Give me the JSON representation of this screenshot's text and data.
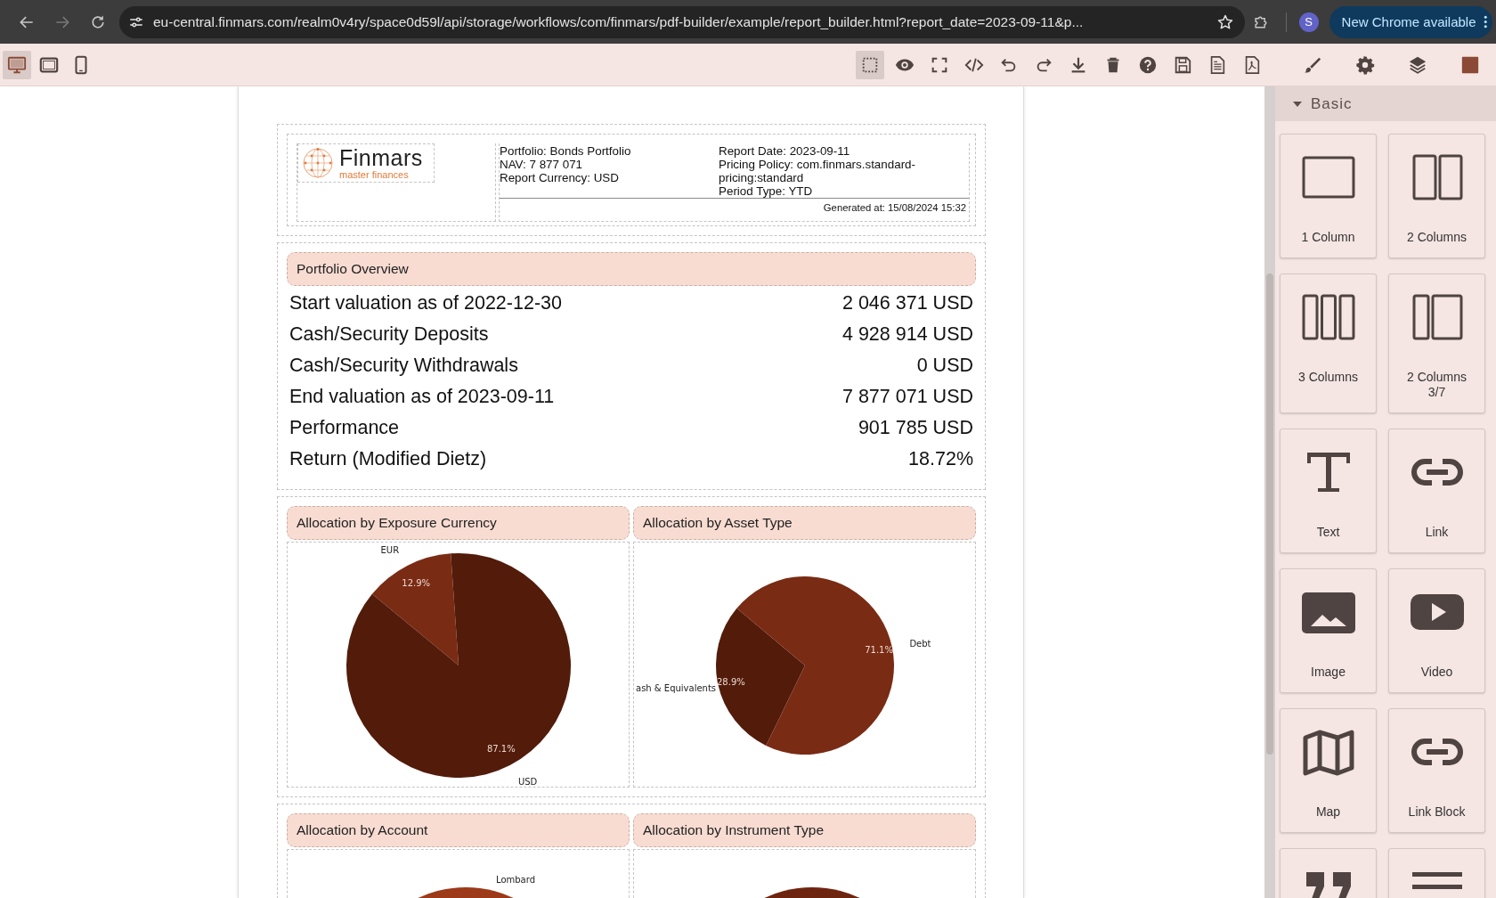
{
  "browser": {
    "url": "eu-central.finmars.com/realm0v4ry/space0d59l/api/storage/workflows/com/finmars/pdf-builder/example/report_builder.html?report_date=2023-09-11&p...",
    "profile_initial": "S",
    "update_button": "New Chrome available"
  },
  "toolbar": {
    "devices": [
      {
        "kind": "desktop",
        "selected": true
      },
      {
        "kind": "tablet",
        "selected": false
      },
      {
        "kind": "mobile",
        "selected": false
      }
    ],
    "commands": [
      {
        "kind": "select",
        "selected": true
      },
      {
        "kind": "preview",
        "selected": false
      },
      {
        "kind": "fullscreen",
        "selected": false
      },
      {
        "kind": "code",
        "selected": false
      },
      {
        "kind": "undo",
        "selected": false
      },
      {
        "kind": "redo",
        "selected": false
      },
      {
        "kind": "download",
        "selected": false
      },
      {
        "kind": "trash",
        "selected": false
      },
      {
        "kind": "help",
        "selected": false
      },
      {
        "kind": "save",
        "selected": false
      },
      {
        "kind": "document",
        "selected": false
      },
      {
        "kind": "pdf",
        "selected": false
      }
    ],
    "panels": [
      {
        "kind": "style",
        "selected": false
      },
      {
        "kind": "settings",
        "selected": false
      },
      {
        "kind": "layers",
        "selected": false
      },
      {
        "kind": "blocks",
        "selected": true
      }
    ]
  },
  "report": {
    "header": {
      "logo_name": "Finmars",
      "logo_tagline": "master finances",
      "info_left": [
        "Portfolio: Bonds Portfolio",
        "NAV: 7 877 071",
        "Report Currency: USD"
      ],
      "info_right": [
        "Report Date: 2023-09-11",
        "Pricing Policy: com.finmars.standard-pricing:standard",
        "Period Type: YTD"
      ],
      "generated": "Generated at: 15/08/2024 15:32"
    },
    "overview": {
      "title": "Portfolio Overview",
      "rows": [
        {
          "label": "Start valuation as of 2022-12-30",
          "value": "2 046 371 USD"
        },
        {
          "label": "Cash/Security Deposits",
          "value": "4 928 914 USD"
        },
        {
          "label": "Cash/Security Withdrawals",
          "value": "0 USD"
        },
        {
          "label": "End valuation as of 2023-09-11",
          "value": "7 877 071 USD"
        },
        {
          "label": "Performance",
          "value": "901 785 USD"
        },
        {
          "label": "Return (Modified Dietz)",
          "value": "18.72%"
        }
      ]
    },
    "charts": [
      {
        "title": "Allocation by Exposure Currency",
        "chart_data": {
          "type": "pie",
          "categories": [
            "EUR",
            "USD"
          ],
          "values": [
            12.9,
            87.1
          ],
          "value_labels": [
            "12.9%",
            "87.1%"
          ]
        }
      },
      {
        "title": "Allocation by Asset Type",
        "chart_data": {
          "type": "pie",
          "categories": [
            "ash & Equivalents",
            "Debt"
          ],
          "values": [
            28.9,
            71.1
          ],
          "value_labels": [
            "28.9%",
            "71.1%"
          ]
        }
      }
    ],
    "lower_sections": [
      {
        "title": "Allocation by Account",
        "labels": [
          "Lombard"
        ]
      },
      {
        "title": "Allocation by Instrument Type"
      }
    ]
  },
  "blocks": {
    "category": {
      "label": "Basic",
      "expanded": true
    },
    "items": [
      {
        "kind": "one-column",
        "label": "1 Column"
      },
      {
        "kind": "two-columns",
        "label": "2 Columns"
      },
      {
        "kind": "three-columns",
        "label": "3 Columns"
      },
      {
        "kind": "two-columns-37",
        "label": "2 Columns 3/7"
      },
      {
        "kind": "text",
        "label": "Text"
      },
      {
        "kind": "link",
        "label": "Link"
      },
      {
        "kind": "image",
        "label": "Image"
      },
      {
        "kind": "video",
        "label": "Video"
      },
      {
        "kind": "map",
        "label": "Map"
      },
      {
        "kind": "link",
        "label": "Link Block"
      },
      {
        "kind": "quote"
      },
      {
        "kind": "divider"
      }
    ]
  }
}
